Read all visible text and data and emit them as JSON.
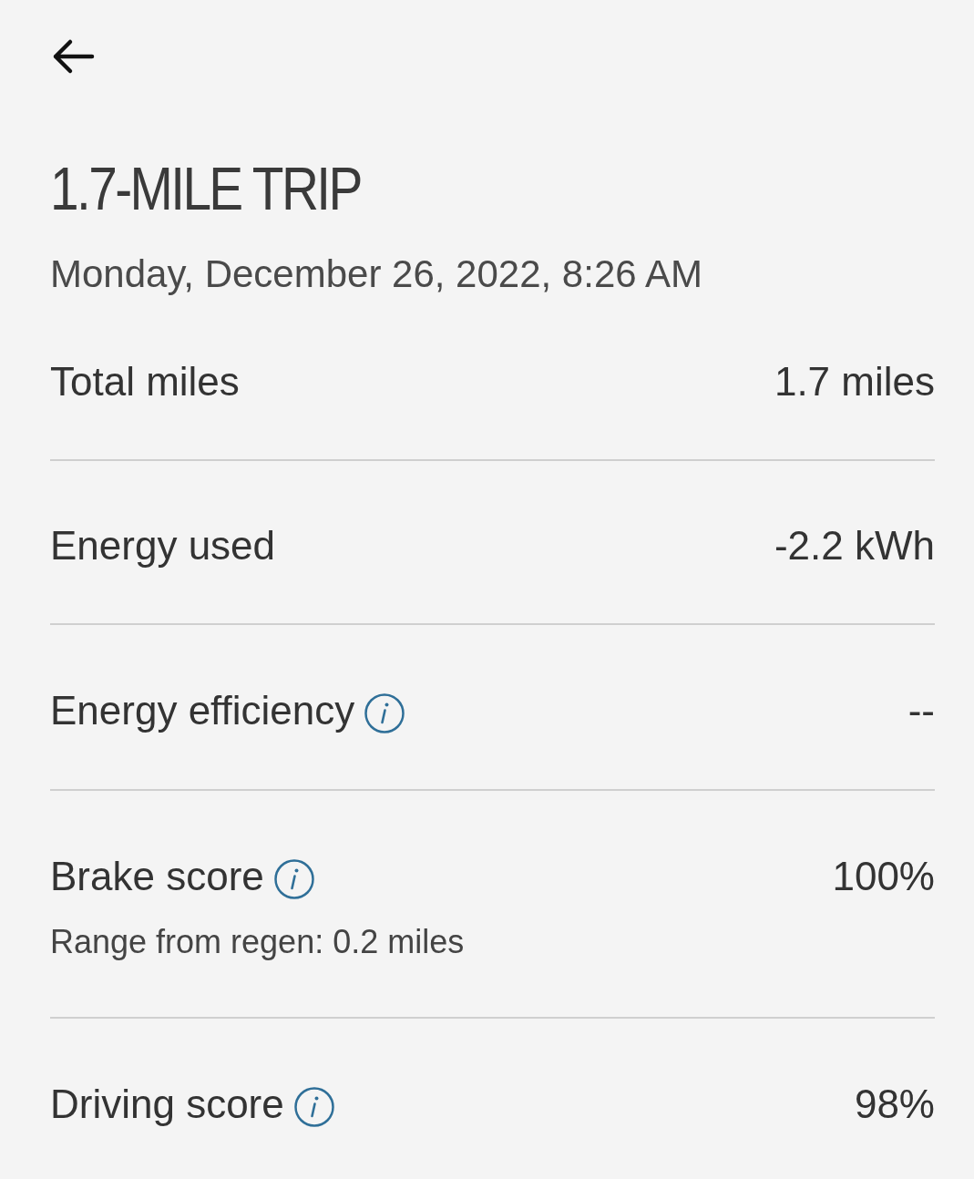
{
  "title": "1.7-MILE TRIP",
  "date": "Monday, December 26, 2022, 8:26 AM",
  "rows": [
    {
      "label": "Total miles",
      "value": "1.7 miles",
      "info": false
    },
    {
      "label": "Energy used",
      "value": "-2.2 kWh",
      "info": false
    },
    {
      "label": "Energy efficiency",
      "value": "--",
      "info": true
    },
    {
      "label": "Brake score",
      "value": "100%",
      "info": true,
      "note": "Range from regen: 0.2 miles"
    },
    {
      "label": "Driving score",
      "value": "98%",
      "info": true
    }
  ]
}
